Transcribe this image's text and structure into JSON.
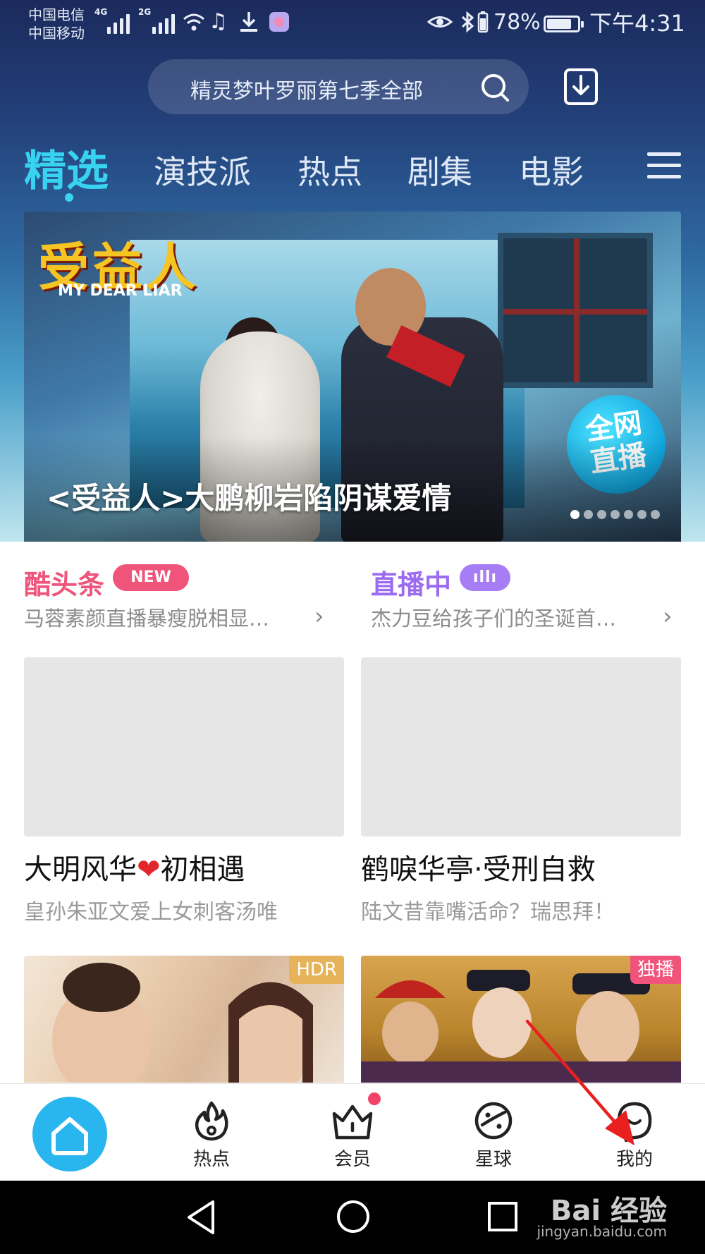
{
  "status_bar": {
    "carrier_1": "中国电信",
    "carrier_2": "中国移动",
    "net_1": "4G",
    "net_2": "2G",
    "battery_percent": "78%",
    "battery_level": 0.78,
    "time": "下午4:31"
  },
  "search": {
    "placeholder": "精灵梦叶罗丽第七季全部"
  },
  "tabs": [
    "精选",
    "演技派",
    "热点",
    "剧集",
    "电影"
  ],
  "active_tab": "精选",
  "banner": {
    "logo_text": "受益人",
    "logo_sub": "MY DEAR LIAR",
    "badge_line_1": "全网",
    "badge_line_2": "直播",
    "title": "<受益人>大鹏柳岩陷阴谋爱情",
    "page_count": 7,
    "current_page": 1
  },
  "info_row": [
    {
      "head": "酷头条",
      "pill": "NEW",
      "sub": "马蓉素颜直播暴瘦脱相显…",
      "head_color": "#f0547b",
      "pill_color": "#f0547b"
    },
    {
      "head": "直播中",
      "pill": "ıllı",
      "sub": "杰力豆给孩子们的圣诞首…",
      "head_color": "#9b6cf0",
      "pill_color": "#a77df5"
    }
  ],
  "cards": [
    {
      "title_a": "大明风华",
      "title_heart": "❤",
      "title_b": "初相遇",
      "sub": "皇孙朱亚文爱上女刺客汤唯"
    },
    {
      "title": "鹤唳华亭·受刑自救",
      "sub": "陆文昔靠嘴活命？瑞思拜！"
    }
  ],
  "lower_cards": [
    {
      "badge": "HDR",
      "badge_color": "#e7b35a"
    },
    {
      "badge": "独播",
      "badge_color": "#f0547b"
    }
  ],
  "bottom_nav": {
    "home": "home-icon",
    "items": [
      "热点",
      "会员",
      "星球",
      "我的"
    ],
    "member_has_dot": true
  },
  "watermark": {
    "main": "Bai 经验",
    "sub": "jingyan.baidu.com"
  },
  "colors": {
    "accent": "#39d3f2",
    "home_blue": "#29b6ee",
    "annotation_arrow": "#e8201f"
  }
}
